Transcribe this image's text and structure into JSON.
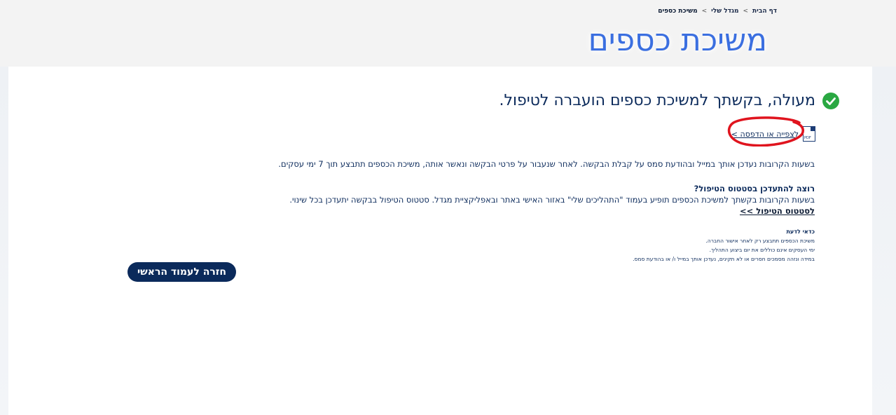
{
  "breadcrumb": {
    "items": [
      {
        "label": "דף הבית"
      },
      {
        "label": "מגדל שלי"
      },
      {
        "label": "משיכת כספים"
      }
    ],
    "separator": ">"
  },
  "page": {
    "title": "משיכת כספים"
  },
  "success": {
    "title": "מעולה, בקשתך למשיכת כספים הועברה לטיפול.",
    "icon": "check-circle-icon",
    "icon_color": "#2aa842"
  },
  "pdf": {
    "link_label": "לצפייה או הדפסה >",
    "icon": "pdf-icon",
    "icon_text": "PDF"
  },
  "info": {
    "paragraph1": "בשעות הקרובות נעדכן אותך במייל ובהודעת סמס על קבלת הבקשה. לאחר שנעבור על פרטי הבקשה ונאשר אותה, משיכת הכספים תתבצע תוך 7 ימי עסקים.",
    "question": "רוצה להתעדכן בסטטוס הטיפול?",
    "paragraph2": "בשעות הקרובות בקשתך למשיכת הכספים תופיע בעמוד \"התהליכים שלי\" באזור האישי באתר ובאפליקציית מגדל. סטטוס הטיפול בבקשה יתעדכן בכל שינוי.",
    "status_link": "לסטטוס הטיפול >>"
  },
  "tips": {
    "heading": "כדאי לדעת",
    "lines": [
      "משיכת הכספים תתבצע רק לאחר אישור החברה.",
      "ימי העסקים אינם כוללים את יום ביצוע התהליך.",
      "במידה ונזהה מסמכים חסרים או לא תקינים, נעדכן אותך במייל ו/ או בהודעת סמס."
    ]
  },
  "actions": {
    "back_label": "חזרה לעמוד הראשי"
  },
  "colors": {
    "title_blue": "#3b6fe0",
    "navy": "#0b2a5b",
    "annotation_red": "#e0141e"
  }
}
